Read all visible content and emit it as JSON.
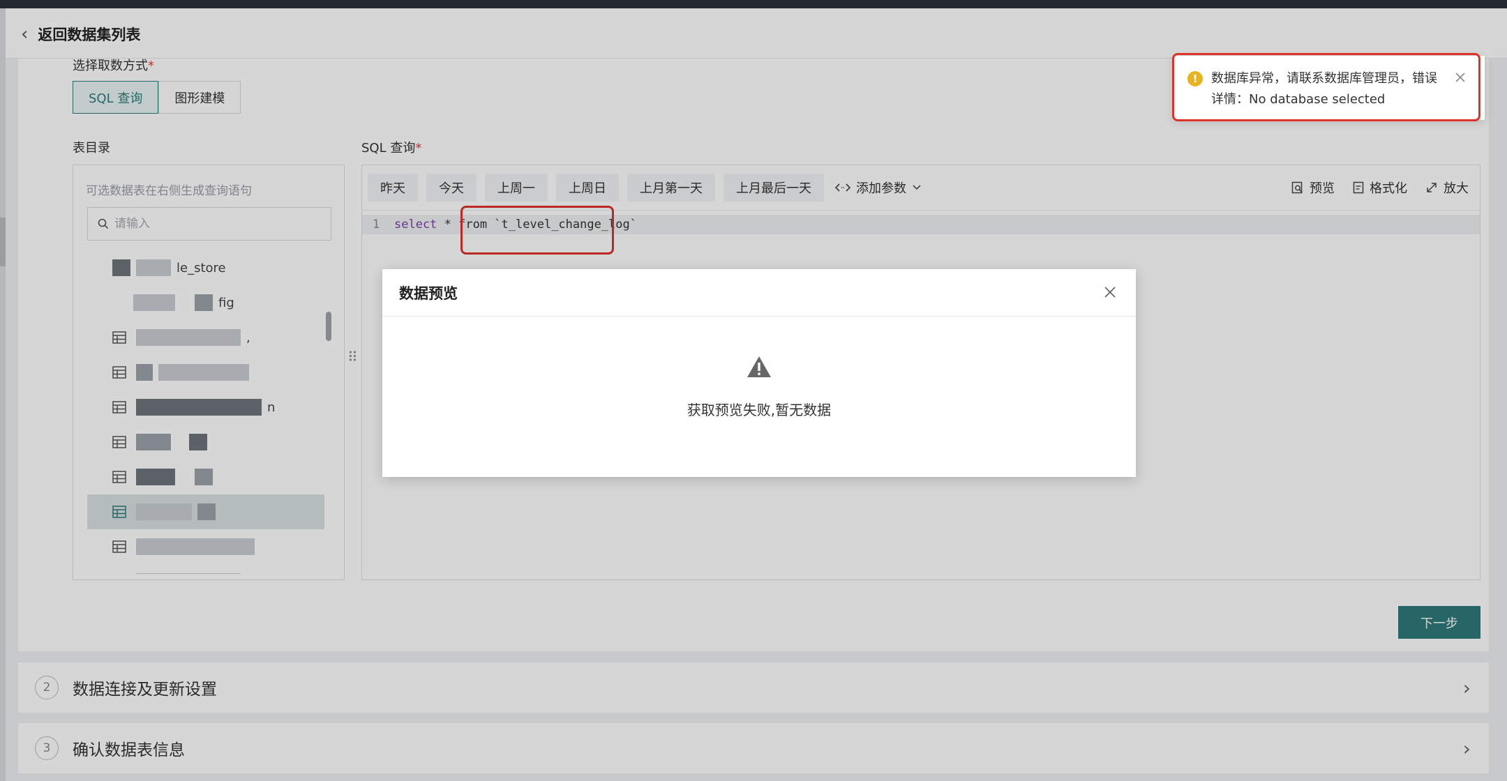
{
  "header": {
    "back_label": "返回数据集列表"
  },
  "form": {
    "method_label": "选择取数方式",
    "method_options": [
      "SQL 查询",
      "图形建模"
    ],
    "catalog_label": "表目录",
    "sql_label": "SQL 查询",
    "required_mark": "*"
  },
  "catalog": {
    "hint": "可选数据表在右侧生成查询语句",
    "search_placeholder": "请输入",
    "items": [
      {
        "text": "le_store"
      },
      {
        "text": "fig"
      },
      {
        "text": ","
      },
      {
        "text": ""
      },
      {
        "text": "n"
      },
      {
        "text": ""
      },
      {
        "text": ""
      },
      {
        "text": ""
      },
      {
        "text": ""
      },
      {
        "text": ""
      }
    ]
  },
  "toolbar": {
    "quick_buttons": [
      "昨天",
      "今天",
      "上周一",
      "上周日",
      "上月第一天",
      "上月最后一天"
    ],
    "add_param": "添加参数",
    "preview": "预览",
    "format": "格式化",
    "expand": "放大"
  },
  "editor": {
    "line_number": "1",
    "keyword_select": "select",
    "code_rest": " * from `t_level_change_log`"
  },
  "next_button": "下一步",
  "steps": [
    {
      "num": "2",
      "title": "数据连接及更新设置"
    },
    {
      "num": "3",
      "title": "确认数据表信息"
    }
  ],
  "modal": {
    "title": "数据预览",
    "message": "获取预览失败,暂无数据"
  },
  "toast": {
    "line1": "数据库异常，请联系数据库管理员，错误",
    "line2": "详情：No database selected"
  },
  "colors": {
    "primary": "#2f7a7a",
    "warning": "#e6b422",
    "highlight_border": "#e0302a"
  }
}
